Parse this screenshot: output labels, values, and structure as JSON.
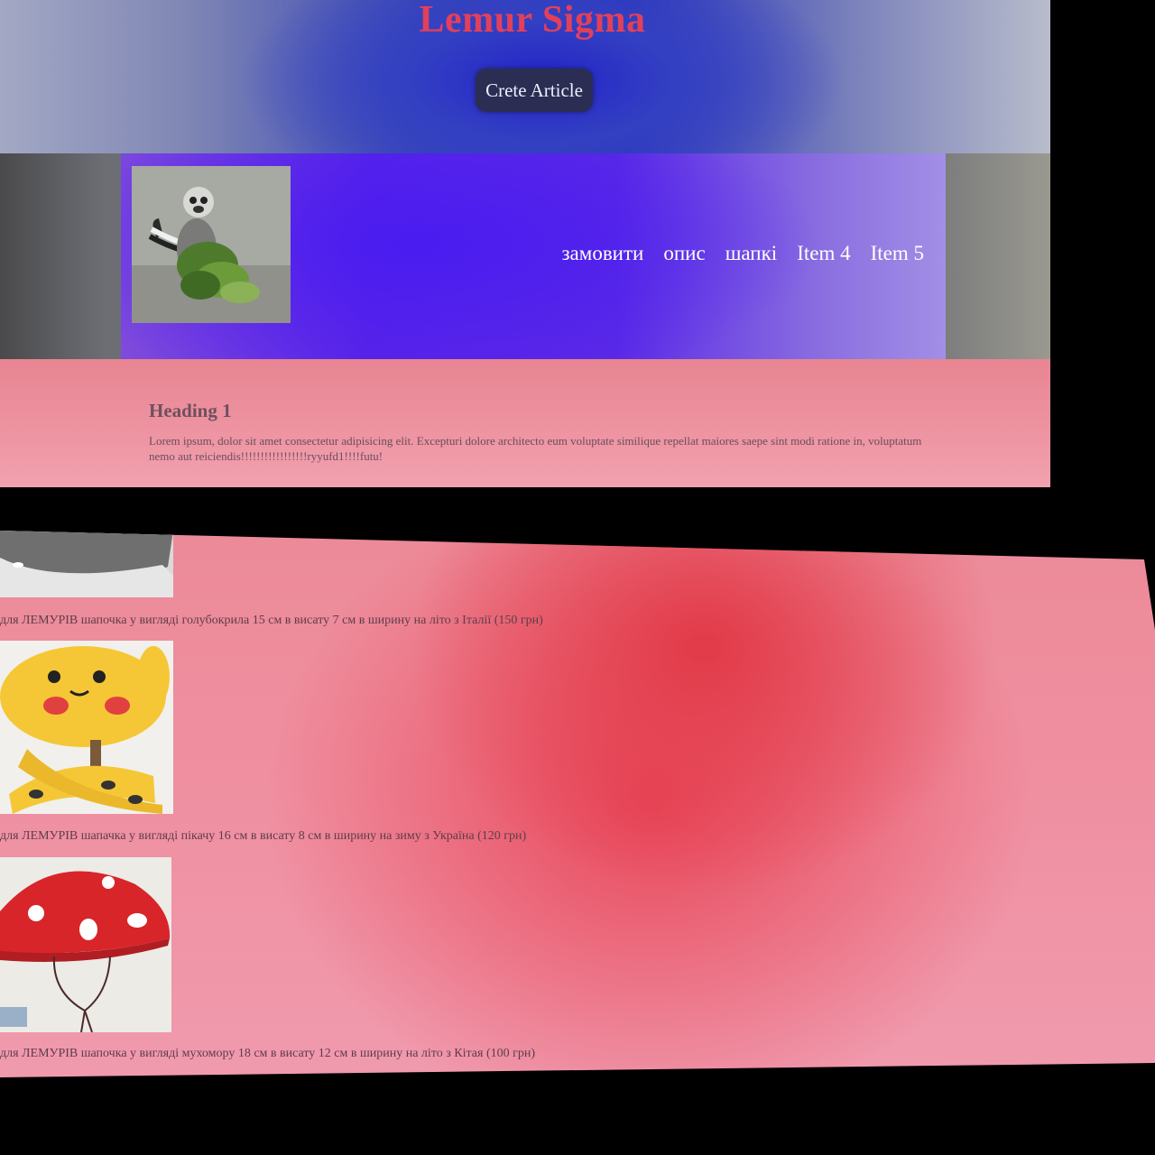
{
  "header": {
    "site_title": "Lemur Sigma",
    "create_button": "Crete Article"
  },
  "nav": {
    "items": [
      {
        "label": "замовити"
      },
      {
        "label": "опис"
      },
      {
        "label": "шапкі"
      },
      {
        "label": "Item 4"
      },
      {
        "label": "Item 5"
      }
    ],
    "logo_icon": "lemur-photo"
  },
  "content": {
    "heading": "Heading 1",
    "paragraph": "Lorem ipsum, dolor sit amet consectetur adipisicing elit. Excepturi dolore architecto eum voluptate similique repellat maiores saepe sint modi ratione in, voluptatum nemo aut reiciendis!!!!!!!!!!!!!!!!!ryyufd1!!!!futu!"
  },
  "products": [
    {
      "image": "pigeon-hat-photo",
      "caption": "для ЛЕМУРІВ шапочка у вигляді голубокрила 15 см в висату 7 см в ширину на літо з Італії (150 грн)"
    },
    {
      "image": "pikachu-hat-photo",
      "caption": "для ЛЕМУРІВ шапачка у вигляді пікачу 16 см в висату 8 см в ширину на зиму з Україна (120 грн)"
    },
    {
      "image": "mushroom-hat-photo",
      "caption": "для ЛЕМУРІВ шапочка у вигляді мухомору 18 см в висату 12 см в ширину на літо з Кітая (100 грн)"
    }
  ],
  "colors": {
    "title": "#e2405a",
    "button_bg": "#2b2e52",
    "nav_bg": "#5a24e8",
    "content_bg": "#ee94a2"
  }
}
